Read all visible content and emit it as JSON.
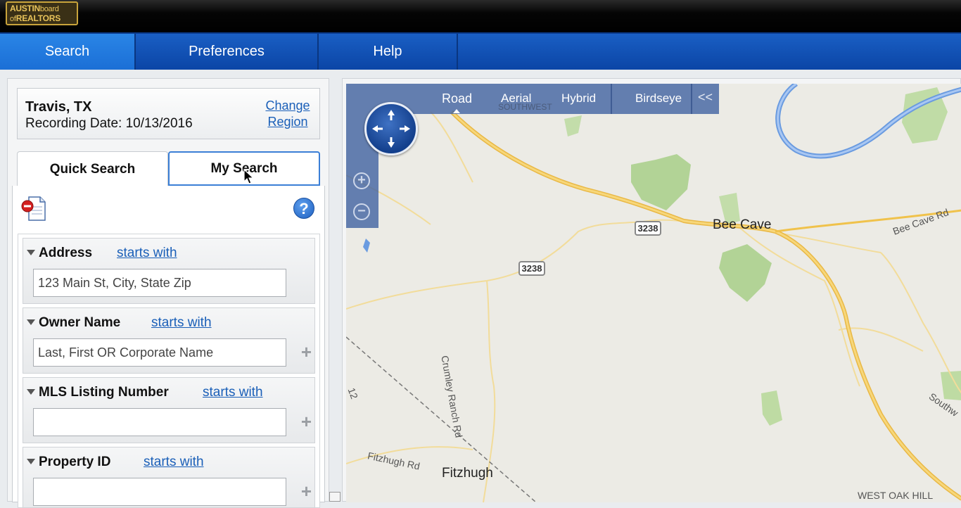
{
  "brand": {
    "line1": "AUSTIN",
    "line1b": "board",
    "line2a": "of",
    "line2b": "REALTORS"
  },
  "nav": {
    "tabs": [
      {
        "label": "Search"
      },
      {
        "label": "Preferences"
      },
      {
        "label": "Help"
      }
    ],
    "active": "Search"
  },
  "region": {
    "name": "Travis, TX",
    "recording_date": "Recording Date: 10/13/2016",
    "change_line1": "Change",
    "change_line2": "Region"
  },
  "search_tabs": {
    "quick": "Quick Search",
    "my": "My Search"
  },
  "fields": [
    {
      "label": "Address",
      "mode": "starts with",
      "placeholder": "123 Main St, City, State Zip"
    },
    {
      "label": "Owner Name",
      "mode": "starts with",
      "placeholder": "Last, First OR Corporate Name"
    },
    {
      "label": "MLS Listing Number",
      "mode": "starts with",
      "placeholder": ""
    },
    {
      "label": "Property ID",
      "mode": "starts with",
      "placeholder": ""
    }
  ],
  "help_glyph": "?",
  "plus_glyph": "+",
  "map": {
    "modes": [
      "Road",
      "Aerial",
      "Hybrid",
      "Birdseye"
    ],
    "active_mode": "Road",
    "collapse": "<<",
    "zoom_in": "+",
    "zoom_out": "−",
    "road_shields": [
      "3238",
      "3238"
    ],
    "places": {
      "bee_cave": "Bee Cave",
      "fitzhugh": "Fitzhugh",
      "west_oak_hill": "WEST OAK HILL",
      "southwest": "SOUTHWEST"
    },
    "roads": {
      "bee_cave_rd": "Bee Cave Rd",
      "crumley": "Crumley Ranch Rd",
      "fitzhugh_rd": "Fitzhugh Rd",
      "southw": "Southw",
      "twelve": "12"
    }
  },
  "colors": {
    "nav_blue": "#0b45a6",
    "link_blue": "#1a5fb8",
    "road_yellow": "#f0c24b",
    "river_blue": "#6a9be0",
    "park_green": "#a8cf88"
  }
}
